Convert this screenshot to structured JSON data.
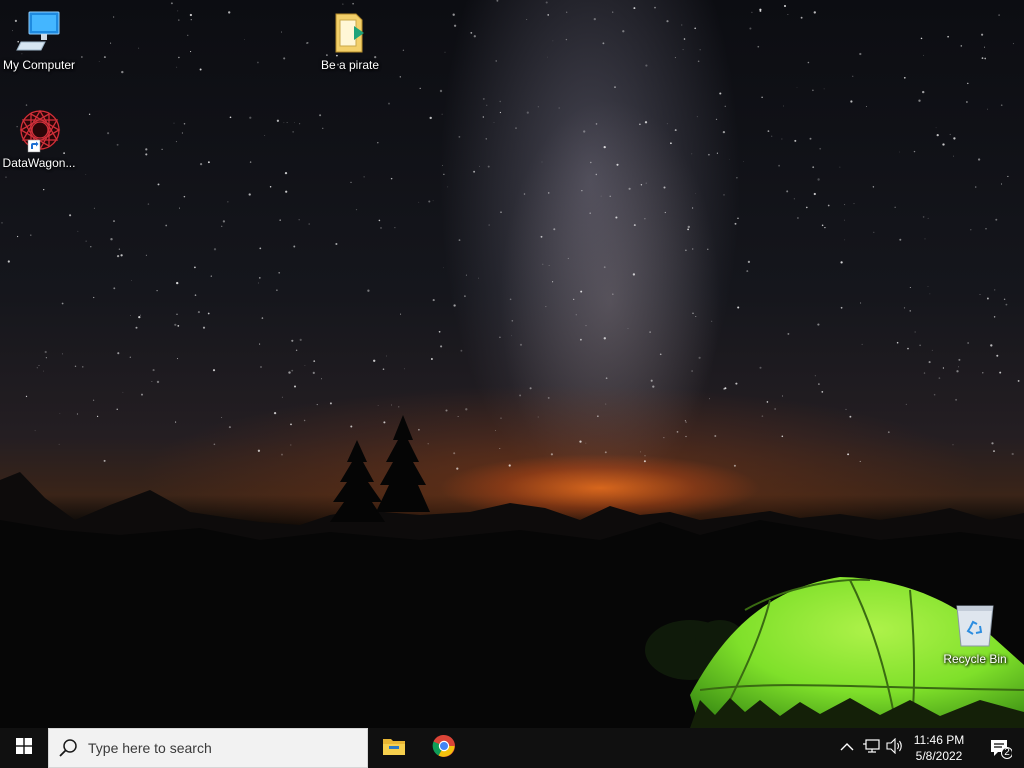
{
  "desktop": {
    "icons": [
      {
        "label": "My Computer",
        "icon": "computer-icon"
      },
      {
        "label": "Be a pirate",
        "icon": "folder-icon"
      },
      {
        "label": "DataWagon...",
        "icon": "datawagon-shortcut-icon"
      },
      {
        "label": "Recycle Bin",
        "icon": "recycle-bin-icon"
      }
    ]
  },
  "taskbar": {
    "start_icon": "windows-logo-icon",
    "search": {
      "placeholder": "Type here to search",
      "icon": "search-icon"
    },
    "pinned": [
      {
        "name": "File Explorer",
        "icon": "file-explorer-icon"
      },
      {
        "name": "Google Chrome",
        "icon": "chrome-icon"
      }
    ],
    "tray": {
      "chevron_icon": "chevron-up-icon",
      "network_icon": "network-icon",
      "volume_icon": "volume-icon",
      "time": "11:46 PM",
      "date": "5/8/2022",
      "notification_icon": "notification-icon",
      "notification_count": "2"
    },
    "colors": {
      "taskbar_bg": "#101010",
      "search_bg": "#f2f2f2",
      "tent_green": "#7fe02a"
    }
  }
}
